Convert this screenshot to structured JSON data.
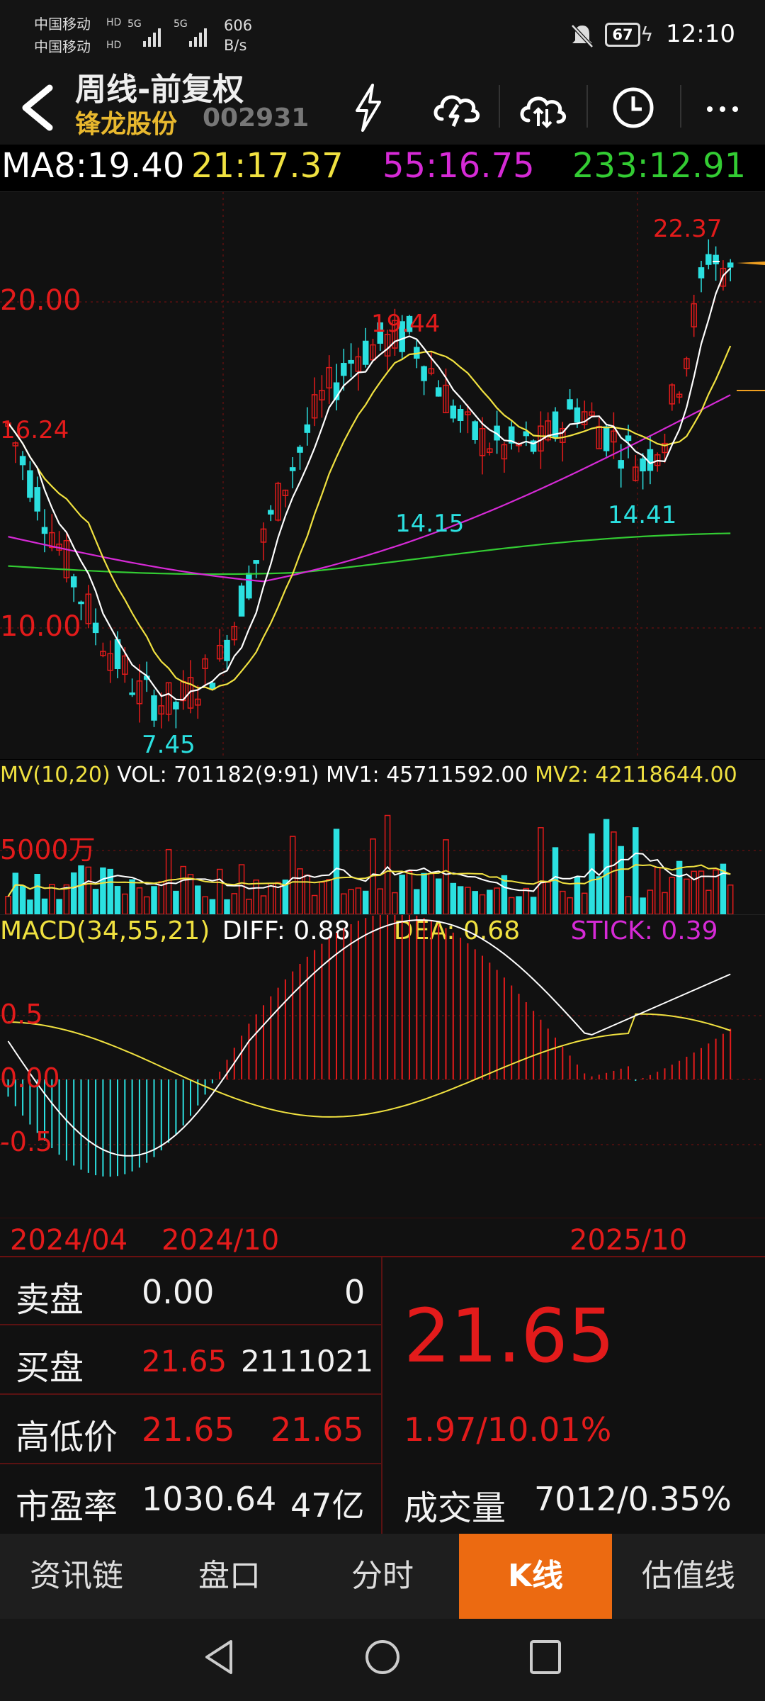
{
  "status_bar": {
    "carrier1": "中国移动",
    "carrier2": "中国移动",
    "net_speed_value": "606",
    "net_speed_unit": "B/s",
    "battery": "67",
    "time": "12:10"
  },
  "header": {
    "title": "周线-前复权",
    "stock_name": "锋龙股份",
    "stock_code": "002931"
  },
  "ma_bar": {
    "ma8": "MA8:19.40",
    "ma21": "21:17.37",
    "ma55": "55:16.75",
    "ma233": "233:12.91"
  },
  "kline": {
    "labels": {
      "y20": "20.00",
      "y1624": "16.24",
      "y10": "10.00",
      "high_19": "19.44",
      "high_22": "22.37",
      "low_745": "7.45",
      "low_1415": "14.15",
      "low_1441": "14.41"
    },
    "colors": {
      "up": "#e31b1b",
      "down": "#2be0e0",
      "ma8": "#ffffff",
      "ma21": "#f0e140",
      "ma55": "#d62ad6",
      "ma233": "#33cc33"
    }
  },
  "volume": {
    "header_mv": "MV(10,20)",
    "header_vol": "VOL: 701182(9:91)",
    "header_mv1": "MV1: 45711592.00",
    "header_mv2": "MV2: 42118644.00",
    "scale_label": "5000万"
  },
  "macd": {
    "header_name": "MACD(34,55,21)",
    "diff": "DIFF: 0.88",
    "dea": "DEA: 0.68",
    "stick": "STICK: 0.39",
    "y05": "0.5",
    "y0": "0.00",
    "ym05": "-0.5"
  },
  "dates": [
    "2024/04",
    "2024/10",
    "2025/10"
  ],
  "quote": {
    "sell_label": "卖盘",
    "sell_price": "0.00",
    "sell_vol": "0",
    "buy_label": "买盘",
    "buy_price": "21.65",
    "buy_vol": "2111021",
    "hl_label": "高低价",
    "high": "21.65",
    "low": "21.65",
    "pe_label": "市盈率",
    "pe": "1030.64",
    "mcap": "47亿",
    "price": "21.65",
    "change": "1.97/10.01%",
    "vol_label": "成交量",
    "vol_value": "7012/0.35%"
  },
  "tabs": [
    "资讯链",
    "盘口",
    "分时",
    "K线",
    "估值线"
  ],
  "active_tab": "K线"
}
